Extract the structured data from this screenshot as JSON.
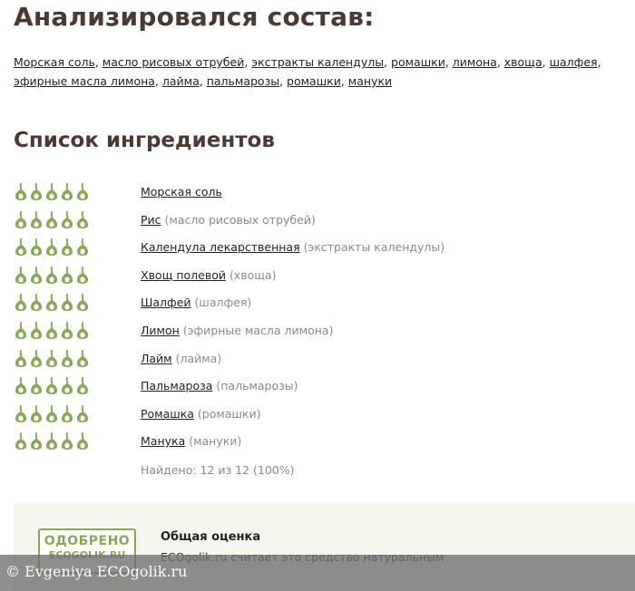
{
  "analysis": {
    "title": "Анализировался состав:",
    "items": [
      "Морская соль",
      "масло рисовых отрубей",
      "экстракты календулы",
      "ромашки",
      "лимона",
      "хвоща",
      "шалфея",
      "эфирные масла лимона",
      "лайма",
      "пальмарозы",
      "ромашки",
      "мануки"
    ]
  },
  "ingredients": {
    "title": "Список ингредиентов",
    "leaf_color": "#8aa85b",
    "rows": [
      {
        "name": "Морская соль",
        "orig": "",
        "rating": 5
      },
      {
        "name": "Рис",
        "orig": "(масло рисовых отрубей)",
        "rating": 5
      },
      {
        "name": "Календула лекарственная",
        "orig": "(экстракты календулы)",
        "rating": 5
      },
      {
        "name": "Хвощ полевой",
        "orig": "(хвоща)",
        "rating": 5
      },
      {
        "name": "Шалфей",
        "orig": "(шалфея)",
        "rating": 5
      },
      {
        "name": "Лимон",
        "orig": "(эфирные масла лимона)",
        "rating": 5
      },
      {
        "name": "Лайм",
        "orig": "(лайма)",
        "rating": 5
      },
      {
        "name": "Пальмароза",
        "orig": "(пальмарозы)",
        "rating": 5
      },
      {
        "name": "Ромашка",
        "orig": "(ромашки)",
        "rating": 5
      },
      {
        "name": "Манука",
        "orig": "(мануки)",
        "rating": 5
      }
    ],
    "found_text": "Найдено: 12 из 12 (100%)"
  },
  "rating": {
    "stamp_top": "ОДОБРЕНО",
    "stamp_bottom": "ECOGOLIK.RU",
    "title": "Общая оценка",
    "text": "ECOgolik.ru считает это средство натуральным"
  },
  "watermark": {
    "text": "© Evgeniya ECOgolik.ru"
  }
}
